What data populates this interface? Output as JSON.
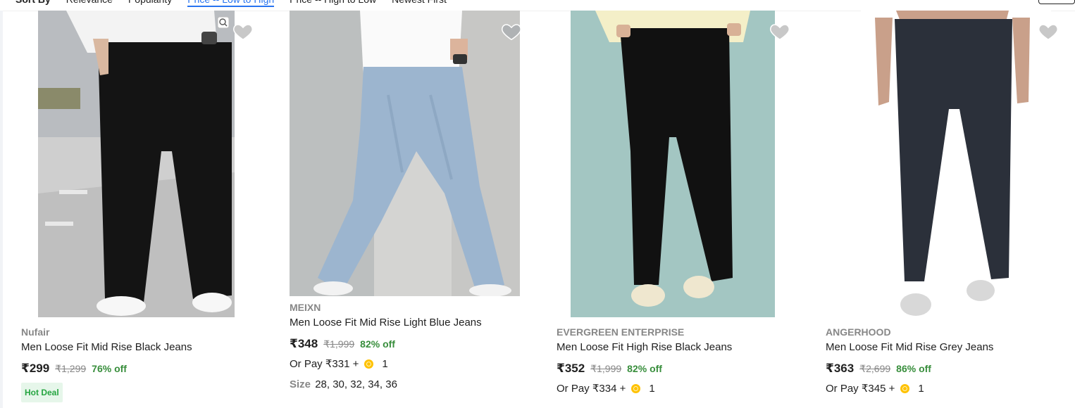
{
  "sort": {
    "label": "Sort By",
    "options": [
      "Relevance",
      "Popularity",
      "Price -- Low to High",
      "Price -- High to Low",
      "Newest First"
    ],
    "active_index": 2
  },
  "colors": {
    "accent": "#2874f0",
    "discount_green": "#388e3c",
    "muted_gray": "#878787",
    "coin_gold": "#ffc200",
    "hot_deal_bg": "#e6f6ea",
    "hot_deal_text": "#26a541"
  },
  "products": [
    {
      "brand": "Nufair",
      "title": "Men Loose Fit Mid Rise Black Jeans",
      "price": "₹299",
      "mrp": "₹1,299",
      "discount": "76% off",
      "badge": "Hot Deal",
      "image_desc": "black-jeans-model",
      "icons": [
        "heart-icon",
        "zoom-icon"
      ]
    },
    {
      "brand": "MEIXN",
      "title": "Men Loose Fit Mid Rise Light Blue Jeans",
      "price": "₹348",
      "mrp": "₹1,999",
      "discount": "82% off",
      "or_pay": "Or Pay ₹331 +",
      "coins": "1",
      "size_label": "Size",
      "sizes": "28, 30, 32, 34, 36",
      "image_desc": "light-blue-jeans-model",
      "icons": [
        "heart-icon"
      ]
    },
    {
      "brand": "EVERGREEN ENTERPRISE",
      "title": "Men Loose Fit High Rise Black Jeans",
      "price": "₹352",
      "mrp": "₹1,999",
      "discount": "82% off",
      "or_pay": "Or Pay ₹334 +",
      "coins": "1",
      "image_desc": "black-jeans-teal-bg",
      "icons": [
        "heart-icon"
      ]
    },
    {
      "brand": "ANGERHOOD",
      "title": "Men Loose Fit Mid Rise Grey Jeans",
      "price": "₹363",
      "mrp": "₹2,699",
      "discount": "86% off",
      "or_pay": "Or Pay ₹345 +",
      "coins": "1",
      "image_desc": "grey-jeans-model",
      "icons": [
        "heart-icon"
      ]
    }
  ]
}
